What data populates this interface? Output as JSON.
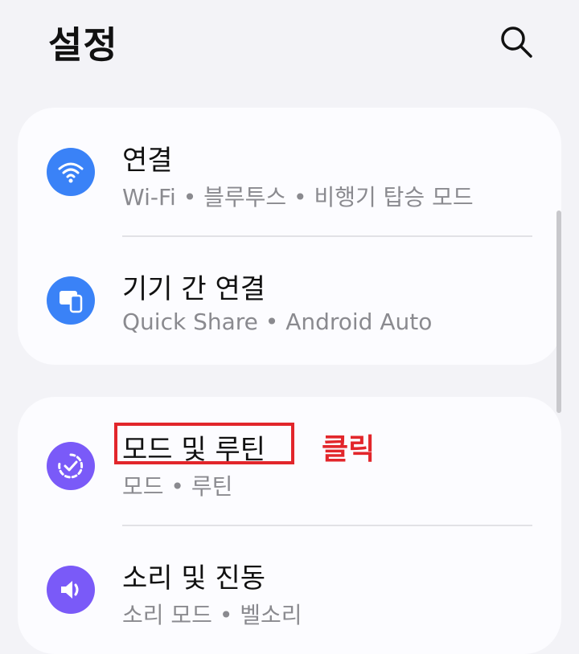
{
  "header": {
    "title": "설정",
    "search_icon": "search-icon"
  },
  "sections": [
    {
      "items": [
        {
          "title": "연결",
          "subtitle": "Wi-Fi  •  블루투스  •  비행기 탑승 모드",
          "icon": "wifi-icon",
          "icon_color": "#3a82f7"
        },
        {
          "title": "기기 간 연결",
          "subtitle": "Quick Share  •  Android Auto",
          "icon": "device-connection-icon",
          "icon_color": "#3a82f7"
        }
      ]
    },
    {
      "items": [
        {
          "title": "모드 및 루틴",
          "subtitle": "모드  •  루틴",
          "icon": "modes-routines-icon",
          "icon_color": "#7a5af8"
        },
        {
          "title": "소리 및 진동",
          "subtitle": "소리 모드  •  벨소리",
          "icon": "sound-icon",
          "icon_color": "#7a5af8"
        }
      ]
    }
  ],
  "annotation": {
    "label": "클릭",
    "color": "#e2262b"
  }
}
